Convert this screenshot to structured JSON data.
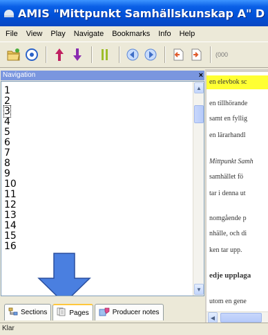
{
  "window": {
    "title": "AMIS \"Mittpunkt Samhällskunskap A\" D"
  },
  "menu": [
    "File",
    "View",
    "Play",
    "Navigate",
    "Bookmarks",
    "Info",
    "Help"
  ],
  "toolbar": {
    "icons": [
      "open-folder-icon",
      "target-icon",
      "arrow-up-icon",
      "arrow-down-icon",
      "pause-icon",
      "back-icon",
      "forward-icon",
      "previous-page-icon",
      "next-page-icon"
    ],
    "overflow_text": "(000"
  },
  "navigation": {
    "header": "Navigation",
    "close_label": "×",
    "pages": [
      "1",
      "2",
      "3",
      "4",
      "5",
      "6",
      "7",
      "8",
      "9",
      "10",
      "11",
      "12",
      "13",
      "14",
      "15",
      "16"
    ],
    "selected": "3",
    "tabs": [
      {
        "label": "Sections",
        "icon": "sections-icon"
      },
      {
        "label": "Pages",
        "icon": "pages-icon"
      },
      {
        "label": "Producer notes",
        "icon": "producer-notes-icon"
      }
    ],
    "active_tab": "Pages"
  },
  "content": {
    "lines": [
      "en elevbok sc",
      "en tillhörande",
      "samt en fyllig",
      "en lärarhandl",
      "Mittpunkt Samh",
      "samhället fö",
      "tar i denna ut",
      "nomgående p",
      "nhälle, och di",
      "ken tar upp.",
      "edje upplaga",
      "utom en gene"
    ]
  },
  "status": {
    "text": "Klar"
  },
  "colors": {
    "titlebar": "#0a5fe6",
    "highlight": "#ffff33",
    "arrow": "#4a7fe0",
    "nav_header": "#7a96df"
  }
}
